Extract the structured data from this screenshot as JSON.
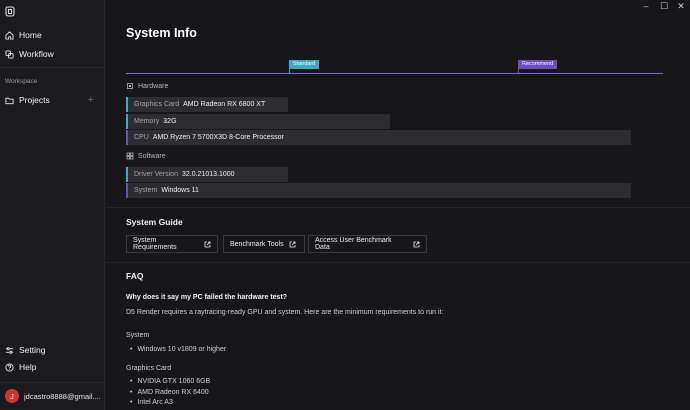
{
  "sidebar": {
    "nav": [
      {
        "label": "Home",
        "icon": "home-icon"
      },
      {
        "label": "Workflow",
        "icon": "workflow-icon"
      }
    ],
    "workspace_label": "Workspace",
    "projects_label": "Projects",
    "bottom": [
      {
        "label": "Setting",
        "icon": "settings-icon"
      },
      {
        "label": "Help",
        "icon": "help-icon"
      }
    ],
    "user": {
      "initial": "J",
      "email": "jdcastro8888@gmail...."
    }
  },
  "main": {
    "title": "System Info",
    "scale": {
      "standard": "Standard",
      "recommend": "Recommend"
    },
    "hardware": {
      "label": "Hardware",
      "graphics": {
        "key": "Graphics Card",
        "value": "AMD Radeon RX 6800 XT"
      },
      "memory": {
        "key": "Memory",
        "value": "32G"
      },
      "cpu": {
        "key": "CPU",
        "value": "AMD Ryzen 7 5700X3D 8-Core Processor"
      }
    },
    "software": {
      "label": "Software",
      "driver": {
        "key": "Driver Version",
        "value": "32.0.21013.1000"
      },
      "system": {
        "key": "System",
        "value": "Windows 11"
      }
    },
    "guide": {
      "title": "System Guide",
      "links": [
        "System Requirements",
        "Benchmark Tools",
        "Access User Benchmark Data"
      ]
    },
    "faq": {
      "title": "FAQ",
      "question": "Why does it say my PC failed the hardware test?",
      "answer": "D5 Render requires a raytracing-ready GPU and system. Here are the minimum requirements to run it:",
      "system_label": "System",
      "system_items": [
        "Windows 10 v1809 or higher"
      ],
      "gpu_label": "Graphics Card",
      "gpu_items": [
        "NVIDIA GTX 1060 6GB",
        "AMD Radeon RX 6400",
        "Intel Arc A3"
      ]
    }
  },
  "colors": {
    "standard": "#3ea8c7",
    "recommend": "#6a4ec1",
    "avatar": "#d2362b"
  }
}
